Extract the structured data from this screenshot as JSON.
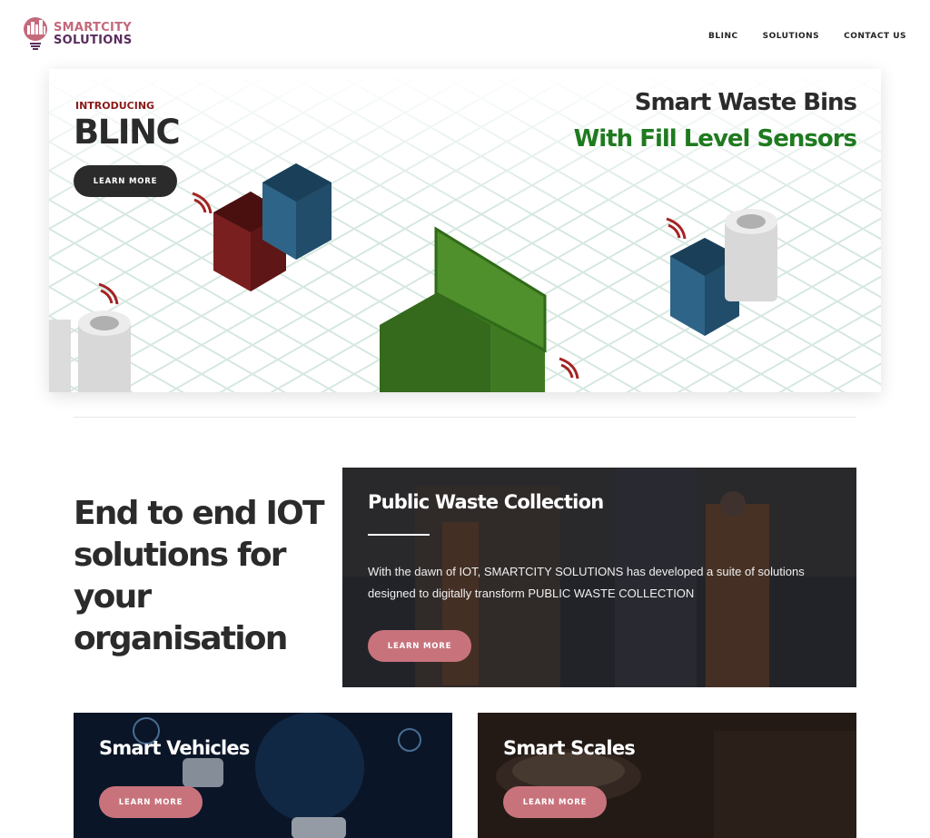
{
  "header": {
    "logo": {
      "line1": "SMARTCITY",
      "line2": "SOLUTIONS",
      "icon": "city-bulb-icon"
    },
    "nav": [
      {
        "label": "BLINC"
      },
      {
        "label": "SOLUTIONS"
      },
      {
        "label": "CONTACT US"
      }
    ]
  },
  "hero": {
    "intro": "INTRODUCING",
    "title": "BLINC",
    "button": "LEARN MORE",
    "headline1": "Smart Waste Bins",
    "headline2": "With Fill Level Sensors"
  },
  "tagline": "End to end IOT solutions for your organisation",
  "cards": {
    "waste": {
      "title": "Public Waste Collection",
      "text": "With the dawn of IOT, SMARTCITY SOLUTIONS has developed a suite of solutions designed to digitally transform PUBLIC WASTE COLLECTION",
      "button": "LEARN MORE"
    },
    "vehicles": {
      "title": "Smart Vehicles",
      "button": "LEARN MORE"
    },
    "scales": {
      "title": "Smart Scales",
      "button": "LEARN MORE"
    }
  },
  "colors": {
    "brand_pink": "#c3697b",
    "brand_purple": "#5a2d5f",
    "green_accent": "#1f7a1f",
    "dark": "#2b2b2b",
    "button_pink": "#c8737c"
  }
}
